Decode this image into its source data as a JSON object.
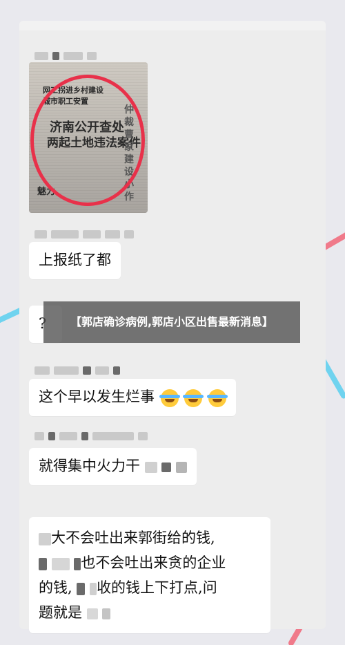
{
  "overlay": {
    "title": "【郭店确诊病例,郭店小区出售最新消息】"
  },
  "photo": {
    "headline_top": "网工拐进乡村建设",
    "headline_mid": "城市职工安置",
    "headline_main": "济南公开查处",
    "headline_sub": "两起土地违法案件",
    "side_text": "仲裁 曹家 建设 小作",
    "footer": "魅力"
  },
  "messages": [
    {
      "text": "上报纸了都"
    },
    {
      "text": "?"
    },
    {
      "text": "这个早以发生烂事"
    },
    {
      "text": "就得集中火力干"
    },
    {
      "line1": "大不会吐出来郭街给的钱,",
      "line2": "也不会吐出来贪的企业",
      "line3": "的钱,",
      "line3b": "收的钱上下打点,问",
      "line4": "题就是"
    }
  ],
  "colors": {
    "accent_red": "#e8314a",
    "emoji_yellow": "#ffcb3b"
  }
}
